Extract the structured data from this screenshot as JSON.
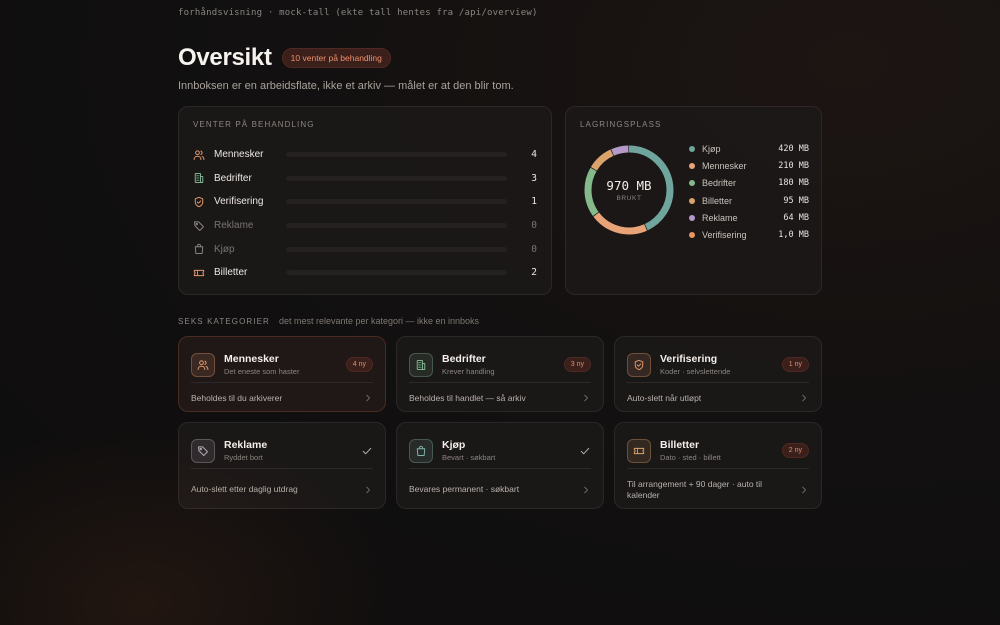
{
  "topnote": "forhåndsvisning · mock-tall (ekte tall hentes fra /api/overview)",
  "header": {
    "title": "Oversikt",
    "pending_badge": "10 venter på behandling",
    "subtitle": "Innboksen er en arbeidsflate, ikke et arkiv — målet er at den blir tom."
  },
  "pending": {
    "title": "VENTER PÅ BEHANDLING",
    "rows": [
      {
        "label": "Mennesker",
        "count": "4",
        "icon": "people-icon",
        "color": "#e69a6d",
        "fraction": 0
      },
      {
        "label": "Bedrifter",
        "count": "3",
        "icon": "building-icon",
        "color": "#7fb392",
        "fraction": 0
      },
      {
        "label": "Verifisering",
        "count": "1",
        "icon": "shield-icon",
        "color": "#e69a6d",
        "fraction": 0
      },
      {
        "label": "Reklame",
        "count": "0",
        "icon": "tag-icon",
        "color": "#8a8480",
        "fraction": 0
      },
      {
        "label": "Kjøp",
        "count": "0",
        "icon": "bag-icon",
        "color": "#8a8480",
        "fraction": 0
      },
      {
        "label": "Billetter",
        "count": "2",
        "icon": "ticket-icon",
        "color": "#e69a6d",
        "fraction": 0
      }
    ]
  },
  "storage": {
    "title": "LAGRINGSPLASS",
    "total": "970 MB",
    "total_label": "BRUKT",
    "items": [
      {
        "label": "Kjøp",
        "size": "420 MB",
        "mb": 420,
        "color": "#6fa59c"
      },
      {
        "label": "Mennesker",
        "size": "210 MB",
        "mb": 210,
        "color": "#e8a478"
      },
      {
        "label": "Bedrifter",
        "size": "180 MB",
        "mb": 180,
        "color": "#84b98c"
      },
      {
        "label": "Billetter",
        "size": "95 MB",
        "mb": 95,
        "color": "#d9a36b"
      },
      {
        "label": "Reklame",
        "size": "64 MB",
        "mb": 64,
        "color": "#b59ac9"
      },
      {
        "label": "Verifisering",
        "size": "1,0 MB",
        "mb": 1,
        "color": "#e5965f"
      }
    ]
  },
  "categories": {
    "title": "SEKS KATEGORIER",
    "desc": "det mest relevante per kategori — ikke en innboks",
    "cards": [
      {
        "name": "Mennesker",
        "desc": "Det eneste som haster",
        "badge": "4 ny",
        "rule": "Beholdes til du arkiverer",
        "icon": "people-icon",
        "accent": "#e69a6d"
      },
      {
        "name": "Bedrifter",
        "desc": "Krever handling",
        "badge": "3 ny",
        "rule": "Beholdes til handlet — så arkiv",
        "icon": "building-icon",
        "accent": "#7fb392"
      },
      {
        "name": "Verifisering",
        "desc": "Koder · selvslettende",
        "badge": "1 ny",
        "rule": "Auto-slett når utløpt",
        "icon": "shield-icon",
        "accent": "#e69a6d"
      },
      {
        "name": "Reklame",
        "desc": "Ryddet bort",
        "badge": "",
        "rule": "Auto-slett etter daglig utdrag",
        "icon": "tag-icon",
        "accent": "#b3aeb8"
      },
      {
        "name": "Kjøp",
        "desc": "Bevart · søkbart",
        "badge": "",
        "rule": "Bevares permanent · søkbart",
        "icon": "bag-icon",
        "accent": "#7fb3a8"
      },
      {
        "name": "Billetter",
        "desc": "Dato · sted · billett",
        "badge": "2 ny",
        "rule": "Til arrangement + 90 dager · auto til kalender",
        "icon": "ticket-icon",
        "accent": "#d9a36b"
      }
    ]
  }
}
